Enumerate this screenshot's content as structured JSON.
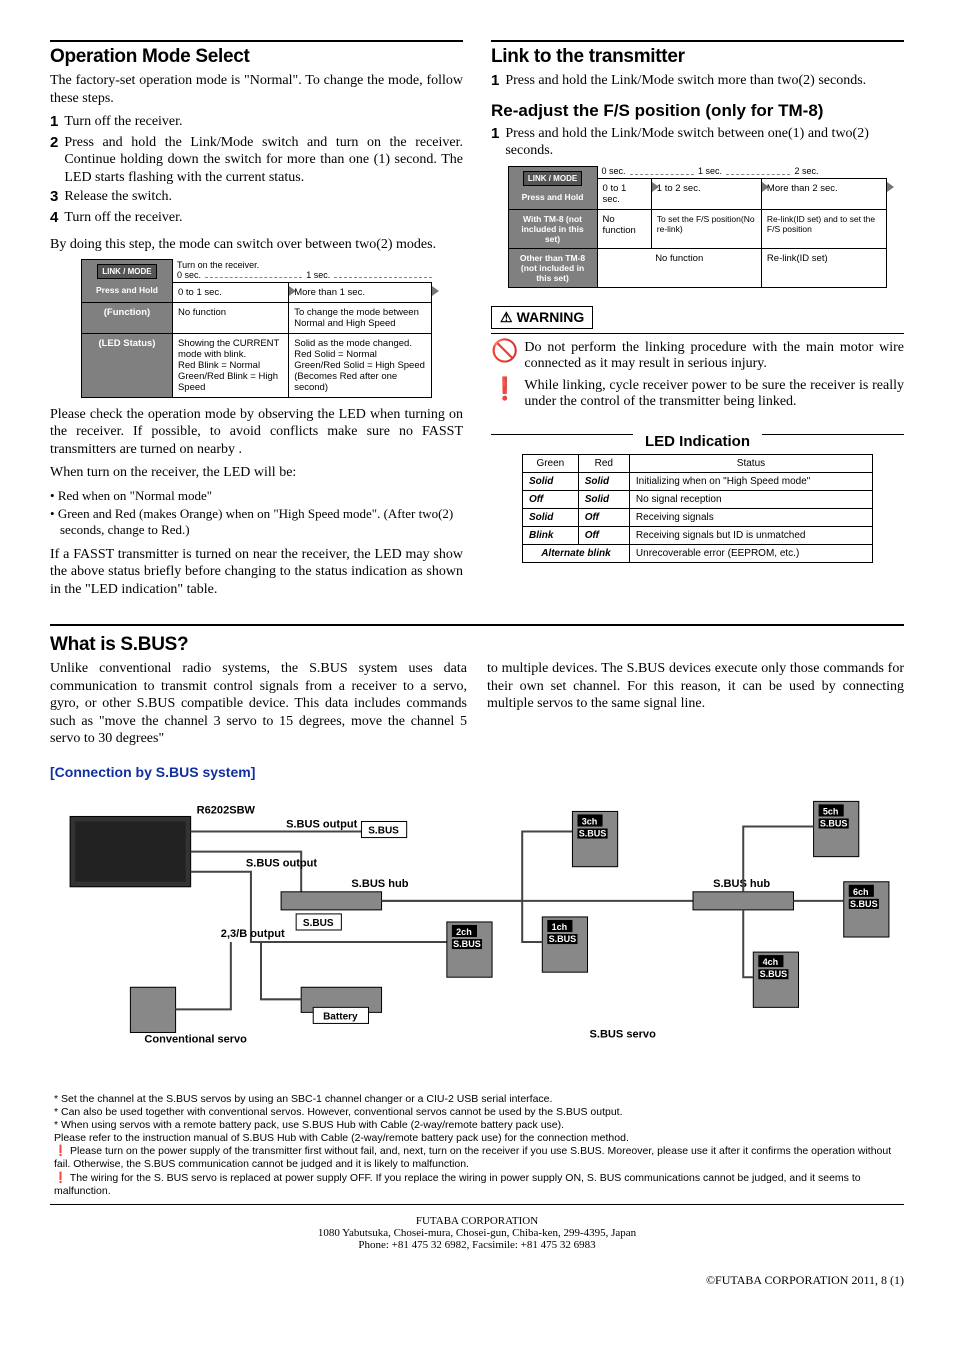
{
  "left": {
    "title": "Operation Mode Select",
    "intro": "The factory-set operation mode is \"Normal\". To change the mode, follow these steps.",
    "steps": [
      "Turn off the receiver.",
      "Press and hold the Link/Mode switch and turn on the receiver. Continue holding down the switch for more than one (1) second. The LED starts flashing with the current status.",
      "Release the switch.",
      "Turn off the receiver."
    ],
    "after_steps": "By doing this step, the mode can switch over between two(2) modes.",
    "mode_table": {
      "caption_top": "Turn on the receiver.",
      "link_btn": "LINK / MODE",
      "press_hold": "Press and Hold",
      "ticks": [
        "0 sec.",
        "1 sec."
      ],
      "cols": [
        "0 to 1 sec.",
        "More than 1 sec."
      ],
      "rows": [
        {
          "l": "(Function)",
          "c1": "No function",
          "c2": "To change the mode between Normal and High Speed"
        },
        {
          "l": "(LED Status)",
          "c1": "Showing the CURRENT mode with blink.\nRed Blink = Normal\nGreen/Red Blink = High Speed",
          "c2": "Solid as the mode changed.\nRed Solid = Normal\nGreen/Red Solid = High Speed\n(Becomes Red after one second)"
        }
      ]
    },
    "after_table": "Please check the operation mode by observing the LED when turning on the receiver. If possible, to avoid conflicts make sure no FASST transmitters are turned on nearby .",
    "when_turn_on": "When turn on the receiver, the LED will be:",
    "bullets": [
      "Red when on \"Normal mode\"",
      "Green and Red (makes Orange) when on \"High Speed mode\". (After two(2) seconds, change to Red.)"
    ],
    "fasst": "If a FASST transmitter is turned on near the receiver, the LED may show the above status briefly before changing to the status indication as shown in the \"LED indication\" table."
  },
  "right": {
    "link_title": "Link to the transmitter",
    "link_step": "Press and hold the Link/Mode switch more than two(2) seconds.",
    "readjust_title": "Re-adjust the F/S position (only for TM-8)",
    "readjust_step": "Press and hold the Link/Mode switch between one(1) and two(2) seconds.",
    "link_table": {
      "link_btn": "LINK / MODE",
      "press_hold": "Press and Hold",
      "ticks": [
        "0 sec.",
        "1 sec.",
        "2 sec."
      ],
      "cols": [
        "0 to 1 sec.",
        "1 to 2 sec.",
        "More than 2 sec."
      ],
      "rows": [
        {
          "l": "With TM-8 (not included in this set)",
          "c1": "No function",
          "c2": "To set the F/S position(No re-link)",
          "c3": "Re-link(ID set) and to set the F/S position"
        },
        {
          "l": "Other than TM-8 (not included in this set)",
          "c12": "No function",
          "c3": "Re-link(ID set)"
        }
      ]
    },
    "warning_label": "WARNING",
    "warn1": "Do not perform the linking procedure with the main motor wire connected as it may result in serious injury.",
    "warn2": "While linking, cycle receiver power to be sure the receiver is really under the control of the transmitter being linked.",
    "led_title": "LED Indication",
    "led_headers": [
      "Green",
      "Red",
      "Status"
    ],
    "led_rows": [
      {
        "g": "Solid",
        "r": "Solid",
        "s": "Initializing when on \"High Speed mode\""
      },
      {
        "g": "Off",
        "r": "Solid",
        "s": "No signal reception"
      },
      {
        "g": "Solid",
        "r": "Off",
        "s": "Receiving signals"
      },
      {
        "g": "Blink",
        "r": "Off",
        "s": "Receiving signals but ID is unmatched"
      },
      {
        "g": "Alternate blink",
        "r": "",
        "s": "Unrecoverable error (EEPROM, etc.)"
      }
    ]
  },
  "sbus": {
    "title": "What is S.BUS?",
    "p1": "Unlike conventional radio systems, the S.BUS system uses data communication to transmit control signals from a receiver to a servo, gyro, or other S.BUS compatible device. This data includes commands such as \"move the channel 3 servo to 15 degrees, move the channel 5 servo to 30 degrees\"",
    "p2": "to multiple devices. The S.BUS devices execute only those commands for their own set channel. For this reason, it can be used by connecting multiple servos to the same signal line.",
    "diagram_title": "[Connection by S.BUS system]",
    "labels": {
      "receiver": "R6202SBW",
      "sbus_out": "S.BUS output",
      "sbus_lbl": "S.BUS",
      "sbus_hub": "S.BUS hub",
      "b_out": "2,3/B output",
      "battery": "Battery",
      "conv": "Conventional servo",
      "sbus_servo": "S.BUS servo",
      "ch1": "1ch",
      "ch2": "2ch",
      "ch3": "3ch",
      "ch4": "4ch",
      "ch5": "5ch",
      "ch6": "6ch",
      "sbus_small": "S.BUS"
    },
    "footnotes": [
      "* Set the channel at the S.BUS servos by using an SBC-1 channel changer or a CIU-2 USB serial interface.",
      "* Can also be used together with conventional servos. However, conventional servos cannot be used by the S.BUS output.",
      "* When using servos with a remote battery pack, use S.BUS Hub with Cable (2-way/remote battery pack use).",
      "  Please refer to the instruction manual of S.BUS Hub with Cable (2-way/remote battery pack use) for the connection method.",
      "❗ Please turn on the power supply of the transmitter first without fail, and, next, turn on the receiver if you use S.BUS.  Moreover, please use it after it confirms the operation without fail. Otherwise, the S.BUS communication cannot be judged and it is likely to malfunction.",
      "❗ The wiring for the S. BUS servo is replaced at power supply OFF.  If you replace the wiring in power supply ON, S. BUS communications cannot be judged, and it seems to malfunction."
    ]
  },
  "footer": {
    "corp": "FUTABA CORPORATION",
    "addr": "1080 Yabutsuka, Chosei-mura, Chosei-gun, Chiba-ken, 299-4395, Japan",
    "phone": "Phone: +81 475 32 6982, Facsimile: +81 475 32 6983",
    "copy": "©FUTABA CORPORATION    2011, 8   (1)"
  }
}
